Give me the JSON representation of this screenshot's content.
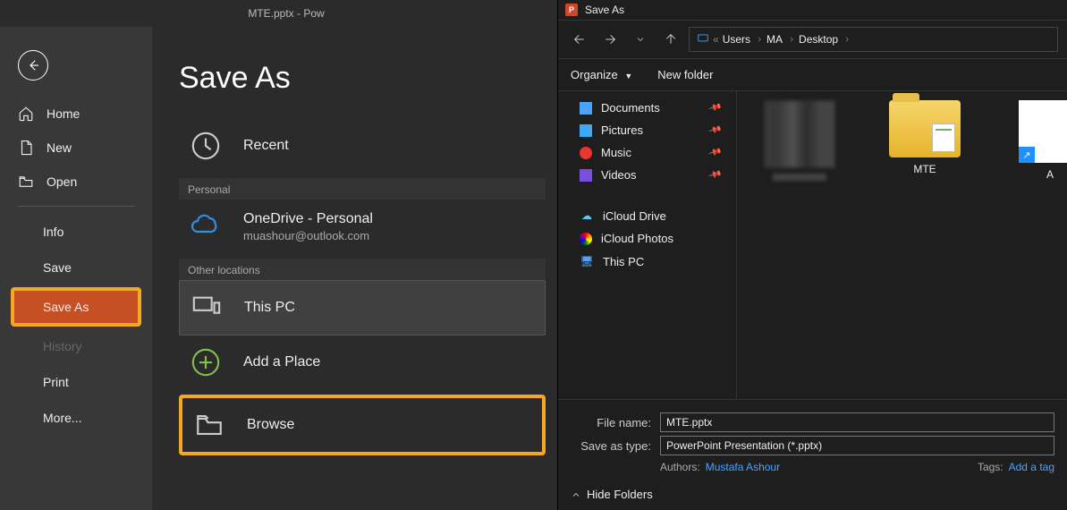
{
  "ppt": {
    "title": "MTE.pptx  -  Pow",
    "page_heading": "Save As",
    "nav": {
      "home": "Home",
      "new": "New",
      "open": "Open",
      "info": "Info",
      "save": "Save",
      "save_as": "Save As",
      "history": "History",
      "print": "Print",
      "more": "More..."
    },
    "locations": {
      "recent": "Recent",
      "section_personal": "Personal",
      "onedrive_title": "OneDrive - Personal",
      "onedrive_sub": "muashour@outlook.com",
      "section_other": "Other locations",
      "this_pc": "This PC",
      "add_place": "Add a Place",
      "browse": "Browse"
    }
  },
  "dialog": {
    "title": "Save As",
    "toolbar": {
      "organize": "Organize",
      "new_folder": "New folder"
    },
    "breadcrumb": {
      "root_glyph": "«",
      "parts": [
        "Users",
        "MA",
        "Desktop"
      ]
    },
    "tree": {
      "documents": "Documents",
      "pictures": "Pictures",
      "music": "Music",
      "videos": "Videos",
      "icloud_drive": "iCloud Drive",
      "icloud_photos": "iCloud Photos",
      "this_pc": "This PC"
    },
    "files": {
      "folder_name": "MTE",
      "shortcut_name": "A"
    },
    "footer": {
      "file_name_label": "File name:",
      "file_name_value": "MTE.pptx",
      "save_type_label": "Save as type:",
      "save_type_value": "PowerPoint Presentation (*.pptx)",
      "authors_label": "Authors:",
      "authors_value": "Mustafa Ashour",
      "tags_label": "Tags:",
      "tags_value": "Add a tag",
      "hide_folders": "Hide Folders"
    }
  }
}
